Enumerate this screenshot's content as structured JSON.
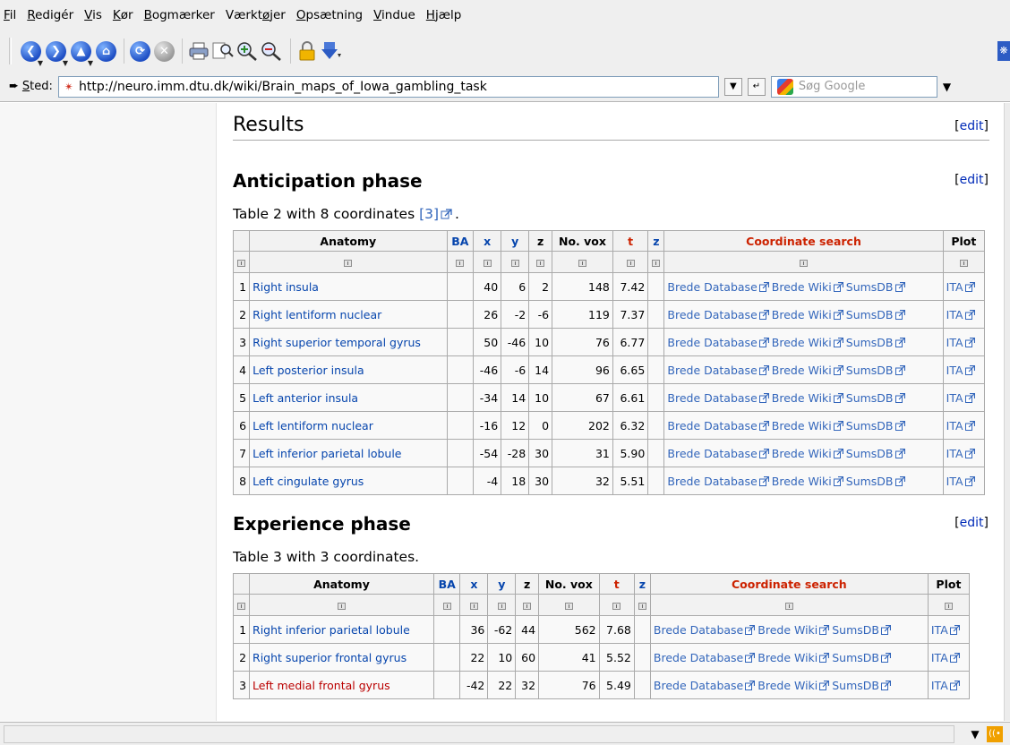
{
  "menu": [
    "Fil",
    "Redigér",
    "Vis",
    "Kør",
    "Bogmærker",
    "Værktøjer",
    "Opsætning",
    "Vindue",
    "Hjælp"
  ],
  "menu_access_keys": [
    "F",
    "R",
    "V",
    "K",
    "B",
    "ø",
    "O",
    "V",
    "H"
  ],
  "location": {
    "label": "Sted:",
    "url": "http://neuro.imm.dtu.dk/wiki/Brain_maps_of_Iowa_gambling_task"
  },
  "search": {
    "placeholder": "Søg Google"
  },
  "page": {
    "results_heading": "Results",
    "edit_label": "edit",
    "anticipation": {
      "heading": "Anticipation phase",
      "caption_prefix": "Table 2 with 8 coordinates ",
      "ref": "[3]",
      "caption_suffix": ".",
      "headers": [
        "Anatomy",
        "BA",
        "x",
        "y",
        "z",
        "No. vox",
        "t",
        "z",
        "Coordinate search",
        "Plot"
      ],
      "rows": [
        {
          "n": "1",
          "anatomy": "Right insula",
          "ba": "",
          "x": "40",
          "y": "6",
          "z": "2",
          "vox": "148",
          "t": "7.42",
          "z2": ""
        },
        {
          "n": "2",
          "anatomy": "Right lentiform nuclear",
          "ba": "",
          "x": "26",
          "y": "-2",
          "z": "-6",
          "vox": "119",
          "t": "7.37",
          "z2": ""
        },
        {
          "n": "3",
          "anatomy": "Right superior temporal gyrus",
          "ba": "",
          "x": "50",
          "y": "-46",
          "z": "10",
          "vox": "76",
          "t": "6.77",
          "z2": ""
        },
        {
          "n": "4",
          "anatomy": "Left posterior insula",
          "ba": "",
          "x": "-46",
          "y": "-6",
          "z": "14",
          "vox": "96",
          "t": "6.65",
          "z2": ""
        },
        {
          "n": "5",
          "anatomy": "Left anterior insula",
          "ba": "",
          "x": "-34",
          "y": "14",
          "z": "10",
          "vox": "67",
          "t": "6.61",
          "z2": ""
        },
        {
          "n": "6",
          "anatomy": "Left lentiform nuclear",
          "ba": "",
          "x": "-16",
          "y": "12",
          "z": "0",
          "vox": "202",
          "t": "6.32",
          "z2": ""
        },
        {
          "n": "7",
          "anatomy": "Left inferior parietal lobule",
          "ba": "",
          "x": "-54",
          "y": "-28",
          "z": "30",
          "vox": "31",
          "t": "5.90",
          "z2": ""
        },
        {
          "n": "8",
          "anatomy": "Left cingulate gyrus",
          "ba": "",
          "x": "-4",
          "y": "18",
          "z": "30",
          "vox": "32",
          "t": "5.51",
          "z2": ""
        }
      ]
    },
    "experience": {
      "heading": "Experience phase",
      "caption": "Table 3 with 3 coordinates.",
      "headers": [
        "Anatomy",
        "BA",
        "x",
        "y",
        "z",
        "No. vox",
        "t",
        "z",
        "Coordinate search",
        "Plot"
      ],
      "rows": [
        {
          "n": "1",
          "anatomy": "Right inferior parietal lobule",
          "ba": "",
          "x": "36",
          "y": "-62",
          "z": "44",
          "vox": "562",
          "t": "7.68",
          "z2": "",
          "missing": false
        },
        {
          "n": "2",
          "anatomy": "Right superior frontal gyrus",
          "ba": "",
          "x": "22",
          "y": "10",
          "z": "60",
          "vox": "41",
          "t": "5.52",
          "z2": "",
          "missing": false
        },
        {
          "n": "3",
          "anatomy": "Left medial frontal gyrus",
          "ba": "",
          "x": "-42",
          "y": "22",
          "z": "32",
          "vox": "76",
          "t": "5.49",
          "z2": "",
          "missing": true
        }
      ]
    },
    "coord_links": [
      "Brede Database",
      "Brede Wiki",
      "SumsDB"
    ],
    "plot_link": "ITA"
  },
  "colors": {
    "link": "#0645ad",
    "external_link": "#3366bb",
    "missing_link": "#ba0000",
    "coordinate_search_header": "#cc2200",
    "chrome_bg": "#efefef"
  },
  "icons": {
    "toolbar": [
      "back-icon",
      "forward-icon",
      "up-icon",
      "home-icon",
      "reload-icon",
      "stop-icon",
      "print-icon",
      "find-icon",
      "zoom-in-icon",
      "zoom-out-icon",
      "lock-icon",
      "download-icon"
    ],
    "external_link": "external-link-icon",
    "sort": "sort-icon"
  }
}
